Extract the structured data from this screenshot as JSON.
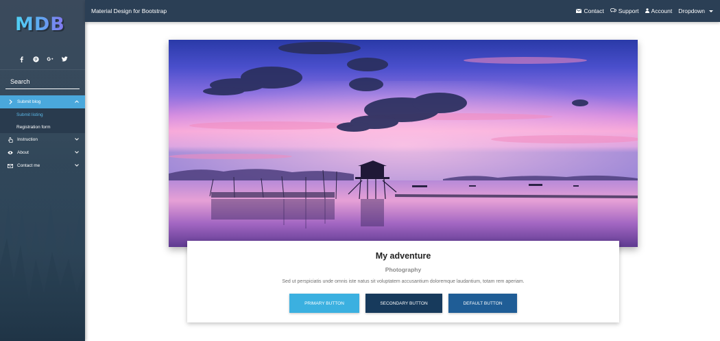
{
  "sidebar": {
    "logo": "MDB",
    "social_icons": [
      "facebook-icon",
      "pinterest-icon",
      "google-plus-icon",
      "twitter-icon"
    ],
    "search": {
      "placeholder": "Search",
      "value": ""
    },
    "menu": [
      {
        "label": "Submit blog",
        "icon": "chevron-right-icon",
        "expanded": true,
        "submenu": [
          {
            "label": "Submit listing",
            "selected": true
          },
          {
            "label": "Registration form",
            "selected": false
          }
        ]
      },
      {
        "label": "Instruction",
        "icon": "hand-pointer-icon",
        "expanded": false
      },
      {
        "label": "About",
        "icon": "eye-icon",
        "expanded": false
      },
      {
        "label": "Contact me",
        "icon": "envelope-icon",
        "expanded": false
      }
    ]
  },
  "navbar": {
    "brand": "Material Design for Bootstrap",
    "links": [
      {
        "label": "Contact",
        "icon": "envelope-icon"
      },
      {
        "label": "Support",
        "icon": "comments-icon"
      },
      {
        "label": "Account",
        "icon": "user-icon"
      },
      {
        "label": "Dropdown",
        "icon": "caret-down-icon"
      }
    ]
  },
  "card": {
    "title": "My adventure",
    "subtitle": "Photography",
    "text": "Sed ut perspiciatis unde omnis iste natus sit voluptatem accusantium doloremque laudantium, totam rem aperiam.",
    "buttons": {
      "primary": "PRIMARY BUTTON",
      "secondary": "SECONDARY BUTTON",
      "default": "DEFAULT BUTTON"
    }
  },
  "colors": {
    "sidebar_bg": "#34495b",
    "navbar_bg": "#2b3f55",
    "active_item": "#4aa8dc",
    "primary": "#3bb0e0",
    "secondary": "#173a5c",
    "default": "#1f5d96"
  }
}
